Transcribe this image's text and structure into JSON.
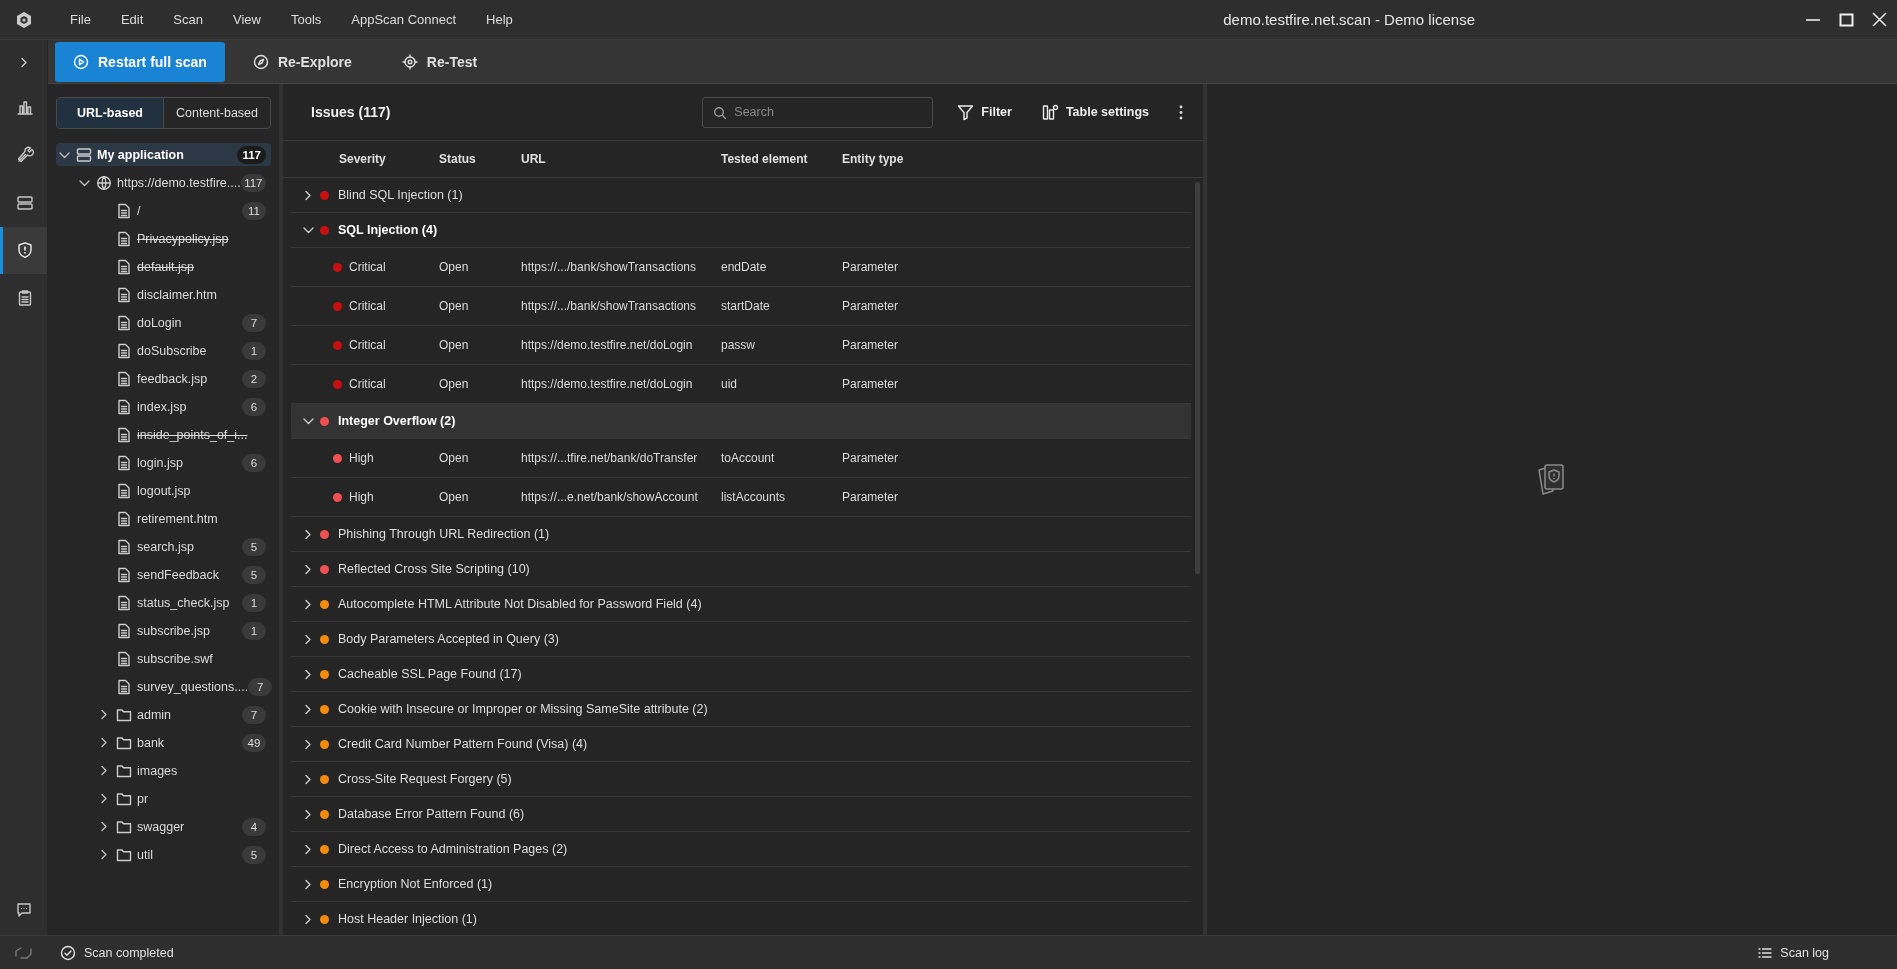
{
  "window": {
    "title": "demo.testfire.net.scan - Demo license"
  },
  "menu": [
    "File",
    "Edit",
    "Scan",
    "View",
    "Tools",
    "AppScan Connect",
    "Help"
  ],
  "toolbar": {
    "buttons": [
      {
        "label": "Restart full scan",
        "kind": "primary"
      },
      {
        "label": "Re-Explore",
        "kind": "explore"
      },
      {
        "label": "Re-Test",
        "kind": "retest"
      }
    ]
  },
  "rail": {
    "items": [
      {
        "kind": "dashboard",
        "selected": false
      },
      {
        "kind": "configure",
        "selected": false
      },
      {
        "kind": "data",
        "selected": false
      },
      {
        "kind": "issues",
        "selected": true
      },
      {
        "kind": "report",
        "selected": false
      }
    ]
  },
  "tree_view": {
    "tabs": [
      {
        "label": "URL-based",
        "selected": true
      },
      {
        "label": "Content-based",
        "selected": false
      }
    ],
    "tree": [
      {
        "label": "My application",
        "count": "117",
        "kind": "app",
        "expanded": true,
        "selected": true,
        "children": [
          {
            "label": "https://demo.testfire....",
            "count": "117",
            "kind": "host",
            "expanded": true,
            "selected": false,
            "children": [
              {
                "label": "/",
                "count": "11",
                "kind": "file",
                "strikethrough": false,
                "selected": false
              },
              {
                "label": "Privacypolicy.jsp",
                "kind": "file",
                "strikethrough": true,
                "selected": false
              },
              {
                "label": "default.jsp",
                "kind": "file",
                "strikethrough": true,
                "selected": false
              },
              {
                "label": "disclaimer.htm",
                "kind": "file",
                "strikethrough": false,
                "selected": false
              },
              {
                "label": "doLogin",
                "count": "7",
                "kind": "file",
                "strikethrough": false,
                "selected": false
              },
              {
                "label": "doSubscribe",
                "count": "1",
                "kind": "file",
                "strikethrough": false,
                "selected": false
              },
              {
                "label": "feedback.jsp",
                "count": "2",
                "kind": "file",
                "strikethrough": false,
                "selected": false
              },
              {
                "label": "index.jsp",
                "count": "6",
                "kind": "file",
                "strikethrough": false,
                "selected": false
              },
              {
                "label": "inside_points_of_i...",
                "kind": "file",
                "strikethrough": true,
                "selected": false
              },
              {
                "label": "login.jsp",
                "count": "6",
                "kind": "file",
                "strikethrough": false,
                "selected": false
              },
              {
                "label": "logout.jsp",
                "kind": "file",
                "strikethrough": false,
                "selected": false
              },
              {
                "label": "retirement.htm",
                "kind": "file",
                "strikethrough": false,
                "selected": false
              },
              {
                "label": "search.jsp",
                "count": "5",
                "kind": "file",
                "strikethrough": false,
                "selected": false
              },
              {
                "label": "sendFeedback",
                "count": "5",
                "kind": "file",
                "strikethrough": false,
                "selected": false
              },
              {
                "label": "status_check.jsp",
                "count": "1",
                "kind": "file",
                "strikethrough": false,
                "selected": false
              },
              {
                "label": "subscribe.jsp",
                "count": "1",
                "kind": "file",
                "strikethrough": false,
                "selected": false
              },
              {
                "label": "subscribe.swf",
                "kind": "file",
                "strikethrough": false,
                "selected": false
              },
              {
                "label": "survey_questions....",
                "count": "7",
                "kind": "file",
                "strikethrough": false,
                "selected": false
              },
              {
                "label": "admin",
                "count": "7",
                "kind": "folder",
                "expanded": false,
                "selected": false
              },
              {
                "label": "bank",
                "count": "49",
                "kind": "folder",
                "expanded": false,
                "selected": false
              },
              {
                "label": "images",
                "kind": "folder",
                "expanded": false,
                "selected": false
              },
              {
                "label": "pr",
                "kind": "folder",
                "expanded": false,
                "selected": false
              },
              {
                "label": "swagger",
                "count": "4",
                "kind": "folder",
                "expanded": false,
                "selected": false
              },
              {
                "label": "util",
                "count": "5",
                "kind": "folder",
                "expanded": false,
                "selected": false
              }
            ]
          }
        ]
      }
    ]
  },
  "issues": {
    "title": "Issues (117)",
    "search": {
      "placeholder": "Search"
    },
    "actions": [
      {
        "label": "Filter",
        "kind": "filter"
      },
      {
        "label": "Table settings",
        "kind": "settings"
      }
    ],
    "columns": [
      "Severity",
      "Status",
      "URL",
      "Tested element",
      "Entity type"
    ],
    "groups": [
      {
        "name": "Blind SQL Injection (1)",
        "color": "#c80f0f",
        "expanded": false,
        "highlighted": false
      },
      {
        "name": "SQL Injection (4)",
        "color": "#c80f0f",
        "expanded": true,
        "highlighted": false,
        "issues": [
          {
            "severity": "Critical",
            "color": "#c80f0f",
            "status": "Open",
            "url": "https://.../bank/showTransactions",
            "tested_element": "endDate",
            "entity_type": "Parameter"
          },
          {
            "severity": "Critical",
            "color": "#c80f0f",
            "status": "Open",
            "url": "https://.../bank/showTransactions",
            "tested_element": "startDate",
            "entity_type": "Parameter"
          },
          {
            "severity": "Critical",
            "color": "#c80f0f",
            "status": "Open",
            "url": "https://demo.testfire.net/doLogin",
            "tested_element": "passw",
            "entity_type": "Parameter"
          },
          {
            "severity": "Critical",
            "color": "#c80f0f",
            "status": "Open",
            "url": "https://demo.testfire.net/doLogin",
            "tested_element": "uid",
            "entity_type": "Parameter"
          }
        ]
      },
      {
        "name": "Integer Overflow (2)",
        "color": "#f0504f",
        "expanded": true,
        "highlighted": true,
        "issues": [
          {
            "severity": "High",
            "color": "#f0504f",
            "status": "Open",
            "url": "https://...tfire.net/bank/doTransfer",
            "tested_element": "toAccount",
            "entity_type": "Parameter"
          },
          {
            "severity": "High",
            "color": "#f0504f",
            "status": "Open",
            "url": "https://...e.net/bank/showAccount",
            "tested_element": "listAccounts",
            "entity_type": "Parameter"
          }
        ]
      },
      {
        "name": "Phishing Through URL Redirection (1)",
        "color": "#f0504f",
        "expanded": false,
        "highlighted": false
      },
      {
        "name": "Reflected Cross Site Scripting (10)",
        "color": "#f0504f",
        "expanded": false,
        "highlighted": false
      },
      {
        "name": "Autocomplete HTML Attribute Not Disabled for Password Field (4)",
        "color": "#f68b0b",
        "expanded": false,
        "highlighted": false
      },
      {
        "name": "Body Parameters Accepted in Query (3)",
        "color": "#f68b0b",
        "expanded": false,
        "highlighted": false
      },
      {
        "name": "Cacheable SSL Page Found (17)",
        "color": "#f68b0b",
        "expanded": false,
        "highlighted": false
      },
      {
        "name": "Cookie with Insecure or Improper or Missing SameSite attribute (2)",
        "color": "#f68b0b",
        "expanded": false,
        "highlighted": false
      },
      {
        "name": "Credit Card Number Pattern Found (Visa) (4)",
        "color": "#f68b0b",
        "expanded": false,
        "highlighted": false
      },
      {
        "name": "Cross-Site Request Forgery (5)",
        "color": "#f68b0b",
        "expanded": false,
        "highlighted": false
      },
      {
        "name": "Database Error Pattern Found (6)",
        "color": "#f68b0b",
        "expanded": false,
        "highlighted": false
      },
      {
        "name": "Direct Access to Administration Pages (2)",
        "color": "#f68b0b",
        "expanded": false,
        "highlighted": false
      },
      {
        "name": "Encryption Not Enforced (1)",
        "color": "#f68b0b",
        "expanded": false,
        "highlighted": false
      },
      {
        "name": "Host Header Injection (1)",
        "color": "#f68b0b",
        "expanded": false,
        "highlighted": false
      }
    ]
  },
  "status_bar": {
    "status": "Scan completed",
    "scan_log": "Scan log"
  }
}
